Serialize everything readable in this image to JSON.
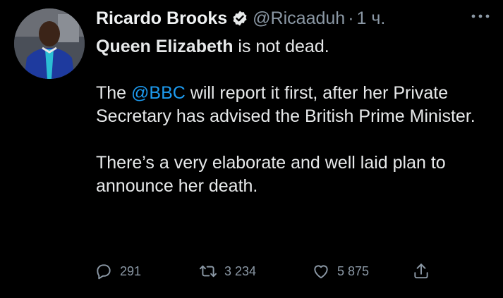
{
  "tweet": {
    "author_name": "Ricardo Brooks",
    "handle": "@Ricaaduh",
    "separator": "·",
    "time": "1 ч.",
    "lines": {
      "p1_bold": "Queen Elizabeth",
      "p1_rest": " is not dead.",
      "p2_pre": "The ",
      "p2_mention": "@BBC",
      "p2_rest": " will report it first, after her Private Secretary has advised the British Prime Minister.",
      "p3": "There’s a very elaborate and well laid plan to announce her death."
    }
  },
  "actions": {
    "reply_count": "291",
    "retweet_count": "3 234",
    "like_count": "5 875"
  },
  "icons": {
    "verified": "verified-badge-icon",
    "more": "more-horizontal-icon",
    "reply": "reply-bubble-icon",
    "retweet": "retweet-icon",
    "like": "heart-icon",
    "share": "share-icon"
  },
  "colors": {
    "background": "#000000",
    "text": "#e7e9ea",
    "secondary": "#8b98a5",
    "mention": "#1d9bf0"
  }
}
